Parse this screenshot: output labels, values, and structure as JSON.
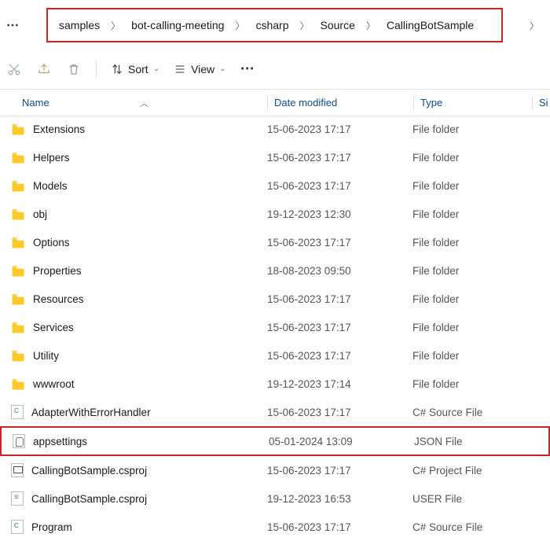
{
  "breadcrumb": [
    "samples",
    "bot-calling-meeting",
    "csharp",
    "Source",
    "CallingBotSample"
  ],
  "toolbar": {
    "sort_label": "Sort",
    "view_label": "View"
  },
  "columns": {
    "name": "Name",
    "date": "Date modified",
    "type": "Type",
    "size": "Si"
  },
  "rows": [
    {
      "icon": "folder",
      "name": "Extensions",
      "date": "15-06-2023 17:17",
      "type": "File folder",
      "cut": true
    },
    {
      "icon": "folder",
      "name": "Helpers",
      "date": "15-06-2023 17:17",
      "type": "File folder"
    },
    {
      "icon": "folder",
      "name": "Models",
      "date": "15-06-2023 17:17",
      "type": "File folder"
    },
    {
      "icon": "folder",
      "name": "obj",
      "date": "19-12-2023 12:30",
      "type": "File folder"
    },
    {
      "icon": "folder",
      "name": "Options",
      "date": "15-06-2023 17:17",
      "type": "File folder"
    },
    {
      "icon": "folder",
      "name": "Properties",
      "date": "18-08-2023 09:50",
      "type": "File folder"
    },
    {
      "icon": "folder",
      "name": "Resources",
      "date": "15-06-2023 17:17",
      "type": "File folder"
    },
    {
      "icon": "folder",
      "name": "Services",
      "date": "15-06-2023 17:17",
      "type": "File folder"
    },
    {
      "icon": "folder",
      "name": "Utility",
      "date": "15-06-2023 17:17",
      "type": "File folder"
    },
    {
      "icon": "folder",
      "name": "wwwroot",
      "date": "19-12-2023 17:14",
      "type": "File folder"
    },
    {
      "icon": "cs",
      "name": "AdapterWithErrorHandler",
      "date": "15-06-2023 17:17",
      "type": "C# Source File"
    },
    {
      "icon": "json",
      "name": "appsettings",
      "date": "05-01-2024 13:09",
      "type": "JSON File",
      "highlight": true
    },
    {
      "icon": "proj",
      "name": "CallingBotSample.csproj",
      "date": "15-06-2023 17:17",
      "type": "C# Project File"
    },
    {
      "icon": "user",
      "name": "CallingBotSample.csproj",
      "date": "19-12-2023 16:53",
      "type": "USER File"
    },
    {
      "icon": "cs",
      "name": "Program",
      "date": "15-06-2023 17:17",
      "type": "C# Source File"
    }
  ]
}
